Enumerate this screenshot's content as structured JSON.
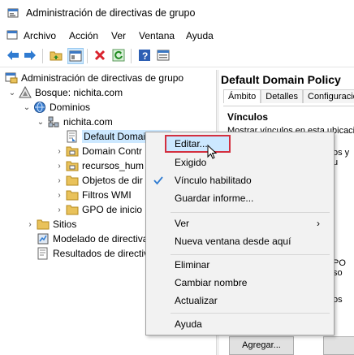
{
  "window": {
    "title": "Administración de directivas de grupo"
  },
  "menubar": [
    "Archivo",
    "Acción",
    "Ver",
    "Ventana",
    "Ayuda"
  ],
  "tree": {
    "root": "Administración de directivas de grupo",
    "forest": "Bosque: nichita.com",
    "domains": "Dominios",
    "domain": "nichita.com",
    "children": [
      "Default Domain Poli",
      "Domain Contr",
      "recursos_hum",
      "Objetos de dir",
      "Filtros WMI",
      "GPO de inicio"
    ],
    "sites": "Sitios",
    "modeling": "Modelado de directiva",
    "results": "Resultados de directiva"
  },
  "right_pane": {
    "title": "Default Domain Policy",
    "tabs": [
      "Ámbito",
      "Detalles",
      "Configuración"
    ],
    "section": "Vínculos",
    "text": "Mostrar vínculos en esta ubicación",
    "fragment1": "os y u",
    "fragment2": "PO so",
    "fragment3": "os",
    "add_button": "Agregar..."
  },
  "context_menu": {
    "items": [
      "Editar...",
      "Exigido",
      "Vínculo habilitado",
      "Guardar informe...",
      "Ver",
      "Nueva ventana desde aquí",
      "Eliminar",
      "Cambiar nombre",
      "Actualizar",
      "Ayuda"
    ]
  }
}
